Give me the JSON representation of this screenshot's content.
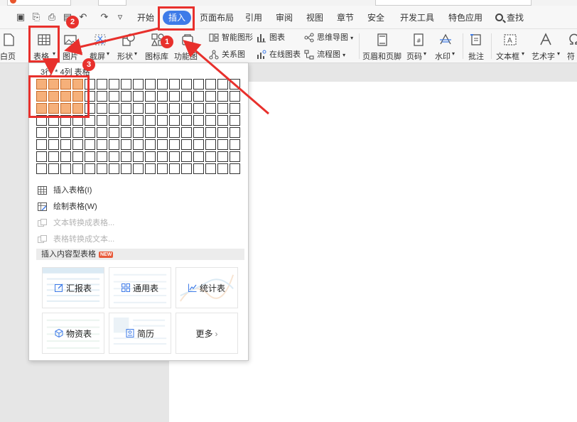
{
  "menu": {
    "tabs": [
      "开始",
      "插入",
      "页面布局",
      "引用",
      "审阅",
      "视图",
      "章节",
      "安全",
      "开发工具",
      "特色应用"
    ],
    "active_tab": "插入",
    "search_label": "查找"
  },
  "ribbon": {
    "blank_page": "白页",
    "table": "表格",
    "picture": "图片",
    "screenshot": "截屏",
    "shape": "形状",
    "icon_library": "图标库",
    "function_chart": "功能图",
    "smart_graphic": "智能图形",
    "chart": "图表",
    "mindmap": "思维导图",
    "relation_graph": "关系图",
    "online_chart": "在线图表",
    "flowchart": "流程图",
    "header_footer": "页眉和页脚",
    "page_number": "页码",
    "watermark": "水印",
    "comment": "批注",
    "textbox": "文本框",
    "wordart": "艺术字",
    "symbol": "符"
  },
  "table_dropdown": {
    "grid_caption": "3行 * 4列 表格",
    "grid_rows": 8,
    "grid_cols": 17,
    "selected_rows": 3,
    "selected_cols": 4,
    "items": [
      {
        "label": "插入表格(I)",
        "enabled": true
      },
      {
        "label": "绘制表格(W)",
        "enabled": true
      },
      {
        "label": "文本转换成表格...",
        "enabled": false
      },
      {
        "label": "表格转换成文本...",
        "enabled": false
      }
    ],
    "section_title": "插入内容型表格",
    "new_badge": "NEW",
    "cards": [
      "汇报表",
      "通用表",
      "统计表",
      "物资表",
      "简历",
      "更多"
    ]
  },
  "annotations": {
    "step_1": "1",
    "step_2": "2",
    "step_3": "3",
    "color": "#e8302c"
  },
  "colors": {
    "accent": "#3e7be8",
    "grid_selected": "#f6b07a"
  }
}
